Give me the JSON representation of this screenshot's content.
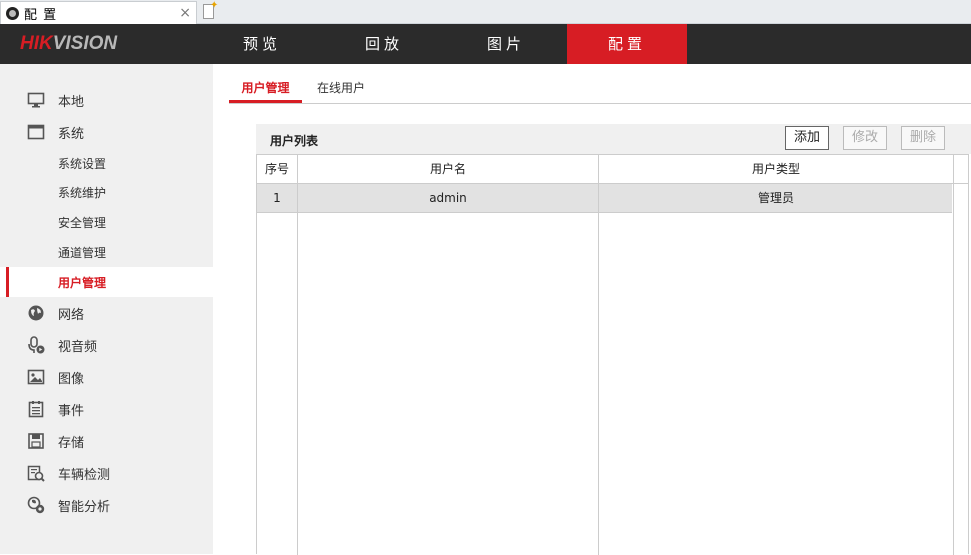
{
  "browser": {
    "tab_title": "配 置",
    "close_glyph": "×"
  },
  "header": {
    "logo_brand": "HIK",
    "logo_rest": "VISION",
    "nav": [
      {
        "label": "预览",
        "active": false
      },
      {
        "label": "回放",
        "active": false
      },
      {
        "label": "图片",
        "active": false
      },
      {
        "label": "配置",
        "active": true
      }
    ]
  },
  "sidebar": {
    "items": [
      {
        "label": "本地",
        "icon": "monitor-icon"
      },
      {
        "label": "系统",
        "icon": "window-icon"
      },
      {
        "label": "网络",
        "icon": "globe-icon"
      },
      {
        "label": "视音频",
        "icon": "microphone-icon"
      },
      {
        "label": "图像",
        "icon": "image-icon"
      },
      {
        "label": "事件",
        "icon": "event-list-icon"
      },
      {
        "label": "存储",
        "icon": "floppy-disk-icon"
      },
      {
        "label": "车辆检测",
        "icon": "vehicle-detection-icon"
      },
      {
        "label": "智能分析",
        "icon": "smart-analysis-icon"
      }
    ],
    "system_sub": [
      {
        "label": "系统设置",
        "active": false
      },
      {
        "label": "系统维护",
        "active": false
      },
      {
        "label": "安全管理",
        "active": false
      },
      {
        "label": "通道管理",
        "active": false
      },
      {
        "label": "用户管理",
        "active": true
      }
    ]
  },
  "content": {
    "tabs": [
      {
        "label": "用户管理",
        "active": true
      },
      {
        "label": "在线用户",
        "active": false
      }
    ],
    "panel_title": "用户列表",
    "buttons": {
      "add": "添加",
      "modify": "修改",
      "delete": "删除"
    },
    "table": {
      "columns": [
        "序号",
        "用户名",
        "用户类型"
      ],
      "rows": [
        {
          "index": "1",
          "username": "admin",
          "type": "管理员"
        }
      ]
    }
  },
  "colors": {
    "accent": "#d71d24",
    "topbar": "#2b2b2b",
    "sidebar": "#f0f0f0"
  }
}
